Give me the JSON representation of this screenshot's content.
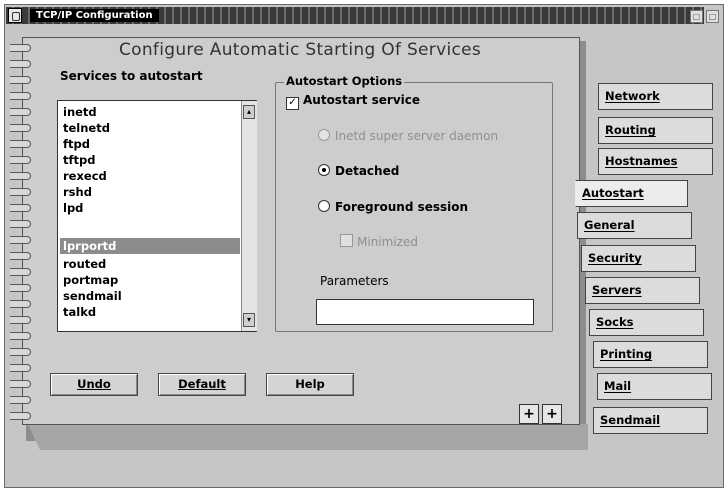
{
  "window": {
    "title": "TCP/IP Configuration"
  },
  "page": {
    "heading": "Configure Automatic Starting Of Services",
    "services_label": "Services to autostart",
    "services": [
      "inetd",
      "telnetd",
      "ftpd",
      "tftpd",
      "rexecd",
      "rshd",
      "lpd",
      "lprportd",
      "routed",
      "portmap",
      "sendmail",
      "talkd"
    ],
    "selected_service": "lprportd",
    "options": {
      "group_label": "Autostart Options",
      "autostart_service": {
        "label": "Autostart service",
        "checked": true
      },
      "inetd_radio": {
        "label": "Inetd super server daemon",
        "enabled": false
      },
      "detached_radio": {
        "label": "Detached",
        "selected": true
      },
      "foreground_radio": {
        "label": "Foreground session",
        "selected": false
      },
      "minimized": {
        "label": "Minimized",
        "enabled": false
      },
      "parameters_label": "Parameters",
      "parameters_value": ""
    },
    "buttons": {
      "undo": "Undo",
      "default": "Default",
      "help": "Help"
    },
    "page_nav": {
      "prev": "+",
      "next": "+"
    }
  },
  "tabs": {
    "upper": [
      "Network",
      "Routing",
      "Hostnames"
    ],
    "active": "Autostart",
    "lower": [
      "General",
      "Security",
      "Servers",
      "Socks",
      "Printing",
      "Mail",
      "Sendmail"
    ]
  },
  "colors": {
    "selection": "#8c8c8c",
    "face": "#cdcdcd",
    "titlebar": "#2c2c2c"
  }
}
